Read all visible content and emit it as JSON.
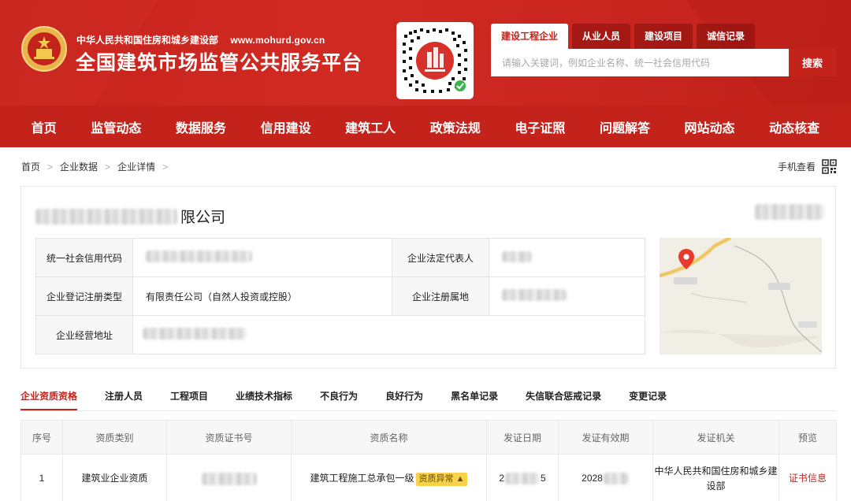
{
  "header": {
    "ministry_name": "中华人民共和国住房和城乡建设部",
    "ministry_url": "www.mohurd.gov.cn",
    "platform_title": "全国建筑市场监管公共服务平台",
    "brand_color": "#c4231c"
  },
  "search": {
    "tabs": [
      {
        "label": "建设工程企业",
        "active": true
      },
      {
        "label": "从业人员",
        "active": false
      },
      {
        "label": "建设项目",
        "active": false
      },
      {
        "label": "诚信记录",
        "active": false
      }
    ],
    "placeholder": "请输入关键词，例如企业名称、统一社会信用代码",
    "button_label": "搜索"
  },
  "nav": {
    "items": [
      "首页",
      "监管动态",
      "数据服务",
      "信用建设",
      "建筑工人",
      "政策法规",
      "电子证照",
      "问题解答",
      "网站动态",
      "动态核查"
    ]
  },
  "breadcrumb": {
    "items": [
      "首页",
      "企业数据",
      "企业详情"
    ]
  },
  "mobile_view": {
    "label": "手机查看",
    "icon": "qr-code-icon"
  },
  "company": {
    "name_suffix": "限公司",
    "info": {
      "credit_code_label": "统一社会信用代码",
      "legal_rep_label": "企业法定代表人",
      "reg_type_label": "企业登记注册类型",
      "reg_type_value": "有限责任公司（自然人投资或控股）",
      "reg_location_label": "企业注册属地",
      "address_label": "企业经营地址"
    }
  },
  "tabs": {
    "items": [
      {
        "label": "企业资质资格",
        "active": true
      },
      {
        "label": "注册人员",
        "active": false
      },
      {
        "label": "工程项目",
        "active": false
      },
      {
        "label": "业绩技术指标",
        "active": false
      },
      {
        "label": "不良行为",
        "active": false
      },
      {
        "label": "良好行为",
        "active": false
      },
      {
        "label": "黑名单记录",
        "active": false
      },
      {
        "label": "失信联合惩戒记录",
        "active": false
      },
      {
        "label": "变更记录",
        "active": false
      }
    ]
  },
  "qualifications": {
    "headers": [
      "序号",
      "资质类别",
      "资质证书号",
      "资质名称",
      "发证日期",
      "发证有效期",
      "发证机关",
      "预览"
    ],
    "rows": [
      {
        "index": "1",
        "category": "建筑业企业资质",
        "name": "建筑工程施工总承包一级",
        "badge": "资质异常",
        "issue_date_prefix": "2",
        "issue_date_suffix": "5",
        "valid_until_prefix": "2028",
        "authority": "中华人民共和国住房和城乡建设部",
        "preview": "证书信息"
      }
    ]
  }
}
